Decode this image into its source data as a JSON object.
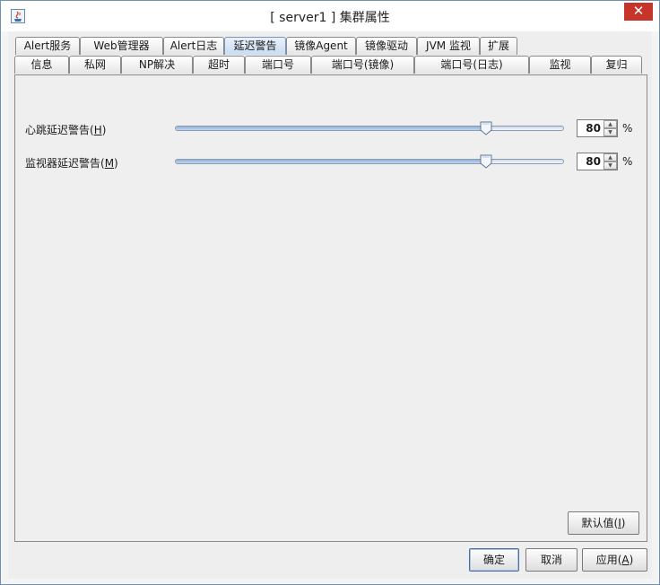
{
  "window": {
    "title": "[ server1 ] 集群属性",
    "close_label": "✕"
  },
  "tabs": {
    "row1": [
      "Alert服务",
      "Web管理器",
      "Alert日志",
      "延迟警告",
      "镜像Agent",
      "镜像驱动",
      "JVM 监视",
      "扩展"
    ],
    "row2": [
      "信息",
      "私网",
      "NP解决",
      "超时",
      "端口号",
      "端口号(镜像)",
      "端口号(日志)",
      "监视",
      "复归"
    ],
    "selected": "延迟警告"
  },
  "settings": {
    "heartbeat": {
      "label": "心跳延迟警告(",
      "mnemonic": "H",
      "label_end": ")",
      "value": "80",
      "unit": "%",
      "level_fraction": 0.8
    },
    "monitor": {
      "label": "监视器延迟警告(",
      "mnemonic": "M",
      "label_end": ")",
      "value": "80",
      "unit": "%",
      "level_fraction": 0.8
    }
  },
  "buttons": {
    "default_label": "默认值(",
    "default_mnemonic": "I",
    "default_end": ")",
    "ok_label": "确定",
    "cancel_label": "取消",
    "apply_label": "应用(",
    "apply_mnemonic": "A",
    "apply_end": ")"
  },
  "colors": {
    "close_button": "#c7352a",
    "selected_tab": "#c9dcf1"
  }
}
